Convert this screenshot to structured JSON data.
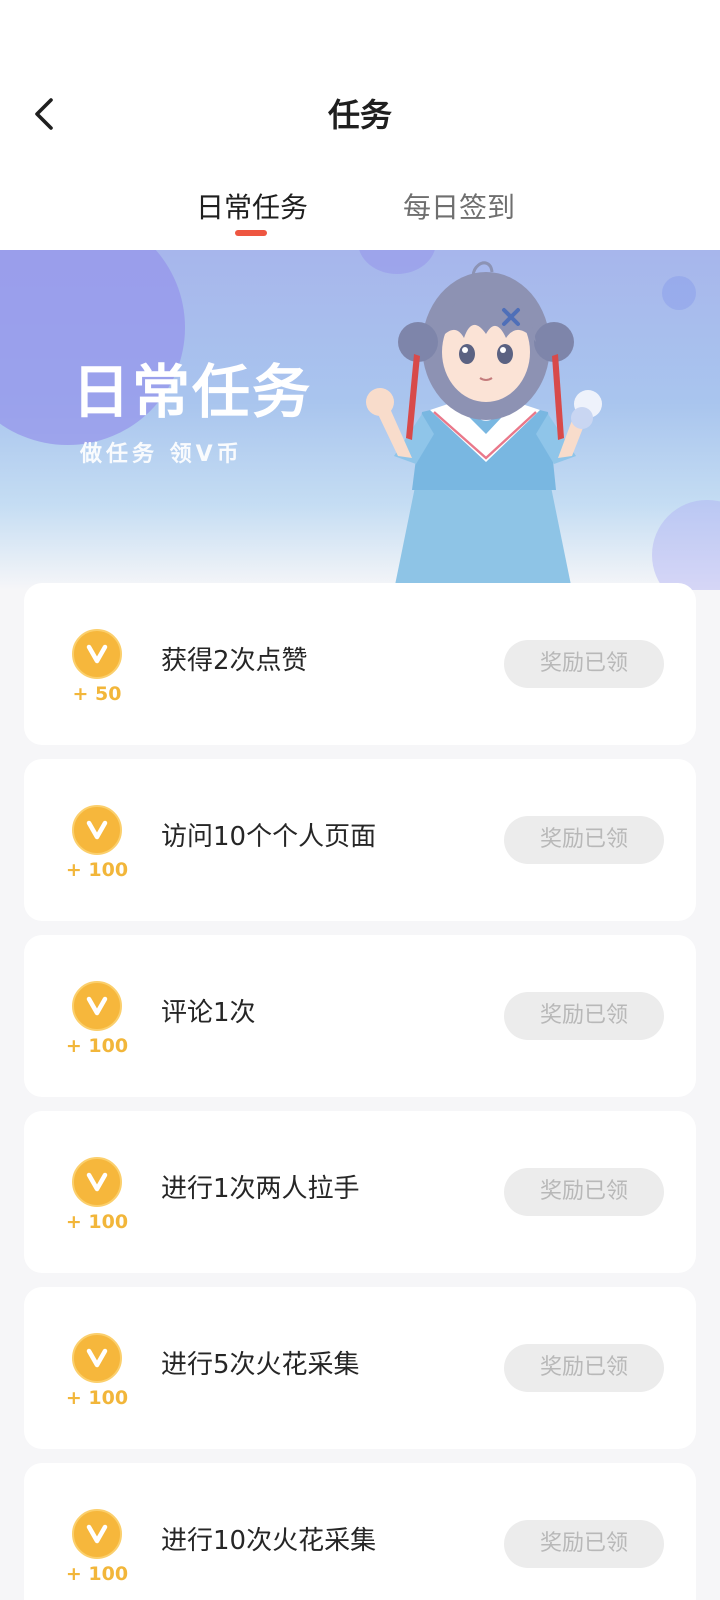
{
  "header": {
    "title": "任务",
    "back_icon": "chevron-left-icon",
    "tabs": [
      {
        "label": "日常任务",
        "active": true
      },
      {
        "label": "每日签到",
        "active": false
      }
    ],
    "accent_color": "#ee5641"
  },
  "banner": {
    "title": "日常任务",
    "subtitle": "做任务 领V币"
  },
  "tasks": [
    {
      "reward": "+ 50",
      "name": "获得2次点赞",
      "status": "奖励已领",
      "icon": "v-coin-icon"
    },
    {
      "reward": "+ 100",
      "name": "访问10个个人页面",
      "status": "奖励已领",
      "icon": "v-coin-icon"
    },
    {
      "reward": "+ 100",
      "name": "评论1次",
      "status": "奖励已领",
      "icon": "v-coin-icon"
    },
    {
      "reward": "+ 100",
      "name": "进行1次两人拉手",
      "status": "奖励已领",
      "icon": "v-coin-icon"
    },
    {
      "reward": "+ 100",
      "name": "进行5次火花采集",
      "status": "奖励已领",
      "icon": "v-coin-icon"
    },
    {
      "reward": "+ 100",
      "name": "进行10次火花采集",
      "status": "奖励已领",
      "icon": "v-coin-icon"
    }
  ],
  "colors": {
    "coin": "#f6b73c",
    "reward_text": "#f2b63a",
    "claimed_bg": "#ececec",
    "claimed_text": "#b8b8b8"
  }
}
